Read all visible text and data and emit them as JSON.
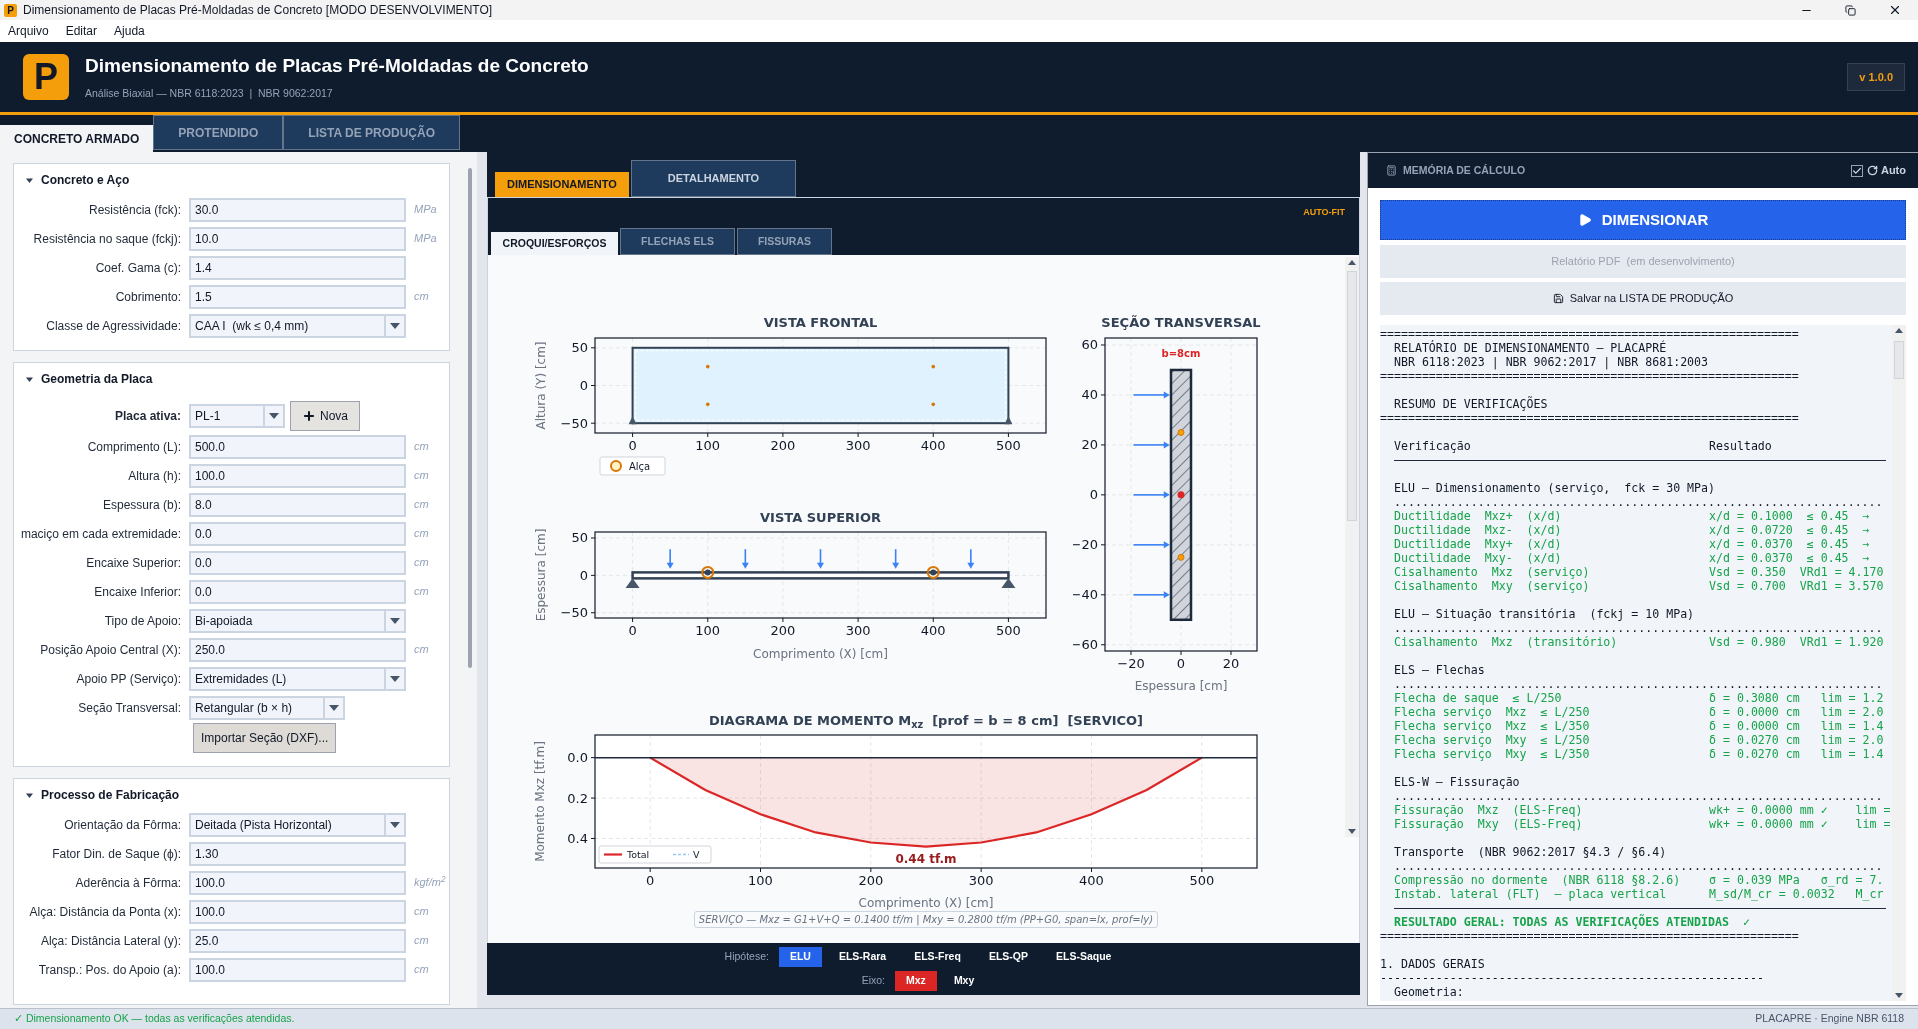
{
  "window": {
    "title": "Dimensionamento de Placas Pré-Moldadas de Concreto [MODO DESENVOLVIMENTO]",
    "app_icon": "P"
  },
  "menu": [
    "Arquivo",
    "Editar",
    "Ajuda"
  ],
  "header": {
    "logo": "P",
    "title": "Dimensionamento de Placas Pré-Moldadas de Concreto",
    "subtitle": "Análise Biaxial — NBR 6118:2023  |  NBR 9062:2017",
    "version": "v 1.0.0"
  },
  "main_tabs": [
    {
      "label": "CONCRETO ARMADO",
      "selected": true
    },
    {
      "label": "PROTENDIDO",
      "selected": false
    },
    {
      "label": "LISTA DE PRODUÇÃO",
      "selected": false
    }
  ],
  "sections": [
    {
      "title": "Concreto e Aço",
      "expanded": true,
      "fields": [
        {
          "kind": "input",
          "label": "Resistência (fck):",
          "value": "30.0",
          "unit": "MPa"
        },
        {
          "kind": "input",
          "label": "Resistência no saque (fckj):",
          "value": "10.0",
          "unit": "MPa"
        },
        {
          "kind": "input",
          "label": "Coef. Gama (c):",
          "value": "1.4"
        },
        {
          "kind": "input",
          "label": "Cobrimento:",
          "value": "1.5",
          "unit": "cm"
        },
        {
          "kind": "select",
          "label": "Classe de Agressividade:",
          "value": "CAA I  (wk ≤ 0,4 mm)"
        }
      ]
    },
    {
      "title": "Geometria da Placa",
      "expanded": true,
      "fields": [
        {
          "kind": "select_action",
          "label": "Placa ativa:",
          "value": "PL-1",
          "button": "Nova"
        },
        {
          "kind": "input",
          "label": "Comprimento (L):",
          "value": "500.0",
          "unit": "cm"
        },
        {
          "kind": "input",
          "label": "Altura (h):",
          "value": "100.0",
          "unit": "cm"
        },
        {
          "kind": "input",
          "label": "Espessura (b):",
          "value": "8.0",
          "unit": "cm"
        },
        {
          "kind": "input",
          "label": "maciço em cada extremidade:",
          "value": "0.0",
          "unit": "cm"
        },
        {
          "kind": "input",
          "label": "Encaixe Superior:",
          "value": "0.0",
          "unit": "cm"
        },
        {
          "kind": "input",
          "label": "Encaixe Inferior:",
          "value": "0.0",
          "unit": "cm"
        },
        {
          "kind": "select",
          "label": "Tipo de Apoio:",
          "value": "Bi-apoiada"
        },
        {
          "kind": "input",
          "label": "Posição Apoio Central (X):",
          "value": "250.0",
          "unit": "cm"
        },
        {
          "kind": "select",
          "label": "Apoio PP (Serviço):",
          "value": "Extremidades (L)"
        },
        {
          "kind": "select_short",
          "label": "Seção Transversal:",
          "value": "Retangular (b × h)"
        },
        {
          "kind": "button",
          "label": "Importar Seção (DXF)..."
        }
      ]
    },
    {
      "title": "Processo de Fabricação",
      "expanded": true,
      "fields": [
        {
          "kind": "select",
          "label": "Orientação da Fôrma:",
          "value": "Deitada (Pista Horizontal)"
        },
        {
          "kind": "input",
          "label": "Fator Din. de Saque (ϕ):",
          "value": "1.30"
        },
        {
          "kind": "input",
          "label": "Aderência à Fôrma:",
          "value": "100.0",
          "unit": "kgf/m$^{2}$"
        },
        {
          "kind": "input",
          "label": "Alça: Distância da Ponta (x):",
          "value": "100.0",
          "unit": "cm"
        },
        {
          "kind": "input",
          "label": "Alça: Distância Lateral (y):",
          "value": "25.0",
          "unit": "cm"
        },
        {
          "kind": "input",
          "label": "Transp.: Pos. do Apoio (a):",
          "value": "100.0",
          "unit": "cm"
        }
      ]
    }
  ],
  "workspace": {
    "tabs": [
      {
        "label": "DIMENSIONAMENTO",
        "selected": true
      },
      {
        "label": "DETALHAMENTO",
        "selected": false
      }
    ],
    "auto_fit": "AUTO-FIT",
    "subtabs": [
      {
        "label": "CROQUI/ESFORÇOS",
        "selected": true
      },
      {
        "label": "FLECHAS ELS",
        "selected": false
      },
      {
        "label": "FISSURAS",
        "selected": false
      }
    ],
    "front_view": {
      "title": "VISTA FRONTAL",
      "ylabel": "Altura (Y) [cm]",
      "legend": "Alça",
      "xticks": [
        "0",
        "100",
        "200",
        "300",
        "400",
        "500"
      ],
      "yticks": [
        "50",
        "0",
        "−50"
      ]
    },
    "top_view": {
      "title": "VISTA SUPERIOR",
      "ylabel": "Espessura [cm]",
      "xlabel": "Comprimento (X) [cm]",
      "xticks": [
        "0",
        "100",
        "200",
        "300",
        "400",
        "500"
      ],
      "yticks": [
        "50",
        "0",
        "−50"
      ]
    },
    "section_view": {
      "title": "SEÇÃO TRANSVERSAL",
      "xlabel": "Espessura [cm]",
      "width_label": "b=8cm",
      "xticks": [
        "−20",
        "0",
        "20"
      ],
      "yticks": [
        "60",
        "40",
        "20",
        "0",
        "−20",
        "−40",
        "−60"
      ]
    },
    "moment": {
      "chart_data": {
        "type": "area",
        "title": "DIAGRAMA DE MOMENTO M$_{xz}$  [prof = b = 8 cm]  [SERVICO]",
        "xlabel": "Comprimento (X) [cm]",
        "ylabel": "Momento Mxz [tf.m]",
        "x": [
          0,
          50,
          100,
          150,
          200,
          250,
          300,
          350,
          400,
          450,
          500
        ],
        "series": [
          {
            "name": "Total",
            "color": "#dc2626",
            "values": [
              0,
              0.16,
              0.28,
              0.37,
              0.42,
              0.44,
              0.42,
              0.37,
              0.28,
              0.16,
              0
            ]
          }
        ],
        "xlim": [
          -50,
          550
        ],
        "ylim": [
          0.546,
          -0.112
        ],
        "grid": true,
        "xticks": [
          0,
          100,
          200,
          300,
          400,
          500
        ],
        "yticks": [
          {
            "value": 0,
            "label": "0.0"
          },
          {
            "value": 0.2,
            "label": "0.2"
          },
          {
            "value": 0.4,
            "label": "0.4"
          }
        ],
        "annotations": [
          {
            "text": "0.44 tf.m"
          }
        ]
      },
      "legend": [
        "V"
      ],
      "note": "SERVIÇO — Mxz = G1+V+Q = 0.1400 tf/m | Mxy = 0.2800 tf/m (PP+G0, span=lx, prof=ly)"
    },
    "hypotheses": {
      "label": "Hipótese:",
      "options": [
        {
          "label": "ELU",
          "selected": true
        },
        {
          "label": "ELS-Rara",
          "selected": false
        },
        {
          "label": "ELS-Freq",
          "selected": false
        },
        {
          "label": "ELS-QP",
          "selected": false
        },
        {
          "label": "ELS-Saque",
          "selected": false
        }
      ]
    },
    "axis": {
      "label": "Eixo:",
      "options": [
        {
          "label": "Mxz",
          "selected": true
        },
        {
          "label": "Mxy",
          "selected": false
        }
      ]
    }
  },
  "memory": {
    "title": "MEMÓRIA DE CÁLCULO",
    "auto": {
      "label": "Auto",
      "checked": true
    },
    "run_button": "DIMENSIONAR",
    "pdf_button": {
      "label": "Relatório PDF  (em desenvolvimento)",
      "disabled": true
    },
    "save_button": "Salvar na LISTA DE PRODUÇÃO",
    "report": [
      {
        "kind": "text",
        "text": "============================================================"
      },
      {
        "kind": "text",
        "text": "  RELATÓRIO DE DIMENSIONAMENTO — PLACAPRÉ"
      },
      {
        "kind": "text",
        "text": "  NBR 6118:2023 | NBR 9062:2017 | NBR 8681:2003"
      },
      {
        "kind": "text",
        "text": "============================================================"
      },
      {
        "kind": "gap"
      },
      {
        "kind": "text",
        "text": "  RESUMO DE VERIFICAÇÕES"
      },
      {
        "kind": "text",
        "text": "============================================================"
      },
      {
        "kind": "gap"
      },
      {
        "kind": "text",
        "text": "  Verificação",
        "result": "Resultado"
      },
      {
        "kind": "rule"
      },
      {
        "kind": "gap"
      },
      {
        "kind": "text",
        "text": "  ELU — Dimensionamento (serviço,  fck = 30 MPa)"
      },
      {
        "kind": "text",
        "text": "  ......................................................................"
      },
      {
        "kind": "ok",
        "text": "  Ductilidade  Mxz+  (x/d)",
        "result": "x/d = 0.1000  ≤ 0.45  →"
      },
      {
        "kind": "ok",
        "text": "  Ductilidade  Mxz-  (x/d)",
        "result": "x/d = 0.0720  ≤ 0.45  →"
      },
      {
        "kind": "ok",
        "text": "  Ductilidade  Mxy+  (x/d)",
        "result": "x/d = 0.0370  ≤ 0.45  →"
      },
      {
        "kind": "ok",
        "text": "  Ductilidade  Mxy-  (x/d)",
        "result": "x/d = 0.0370  ≤ 0.45  →"
      },
      {
        "kind": "ok",
        "text": "  Cisalhamento  Mxz  (serviço)",
        "result": "Vsd = 0.350  VRd1 = 4.170"
      },
      {
        "kind": "ok",
        "text": "  Cisalhamento  Mxy  (serviço)",
        "result": "Vsd = 0.700  VRd1 = 3.570"
      },
      {
        "kind": "gap"
      },
      {
        "kind": "text",
        "text": "  ELU — Situação transitória  (fckj = 10 MPa)"
      },
      {
        "kind": "text",
        "text": "  ......................................................................"
      },
      {
        "kind": "ok",
        "text": "  Cisalhamento  Mxz  (transitório)",
        "result": "Vsd = 0.980  VRd1 = 1.920"
      },
      {
        "kind": "gap"
      },
      {
        "kind": "text",
        "text": "  ELS — Flechas"
      },
      {
        "kind": "text",
        "text": "  ......................................................................"
      },
      {
        "kind": "ok",
        "text": "  Flecha de saque  ≤ L/250",
        "result": "δ = 0.3080 cm   lim = 1.2"
      },
      {
        "kind": "ok",
        "text": "  Flecha serviço  Mxz  ≤ L/250",
        "result": "δ = 0.0000 cm   lim = 2.0"
      },
      {
        "kind": "ok",
        "text": "  Flecha serviço  Mxz  ≤ L/350",
        "result": "δ = 0.0000 cm   lim = 1.4"
      },
      {
        "kind": "ok",
        "text": "  Flecha serviço  Mxy  ≤ L/250",
        "result": "δ = 0.0270 cm   lim = 2.0"
      },
      {
        "kind": "ok",
        "text": "  Flecha serviço  Mxy  ≤ L/350",
        "result": "δ = 0.0270 cm   lim = 1.4"
      },
      {
        "kind": "gap"
      },
      {
        "kind": "text",
        "text": "  ELS-W — Fissuração"
      },
      {
        "kind": "text",
        "text": "  ......................................................................"
      },
      {
        "kind": "ok",
        "text": "  Fissuração  Mxz  (ELS-Freq)",
        "result": "wk+ = 0.0000 mm ✓    lim ="
      },
      {
        "kind": "ok",
        "text": "  Fissuração  Mxy  (ELS-Freq)",
        "result": "wk+ = 0.0000 mm ✓    lim ="
      },
      {
        "kind": "gap"
      },
      {
        "kind": "text",
        "text": "  Transporte  (NBR 9062:2017 §4.3 / §6.4)"
      },
      {
        "kind": "text",
        "text": "  ......................................................................"
      },
      {
        "kind": "ok",
        "text": "  Compressão no dormente  (NBR 6118 §8.2.6)",
        "result": "σ = 0.039 MPa   σ_rd = 7."
      },
      {
        "kind": "ok",
        "text": "  Instab. lateral (FLT)  — placa vertical",
        "result": "M_sd/M_cr = 0.0032   M_cr"
      },
      {
        "kind": "rule"
      },
      {
        "kind": "total",
        "text": "  RESULTADO GERAL: TODAS AS VERIFICAÇÕES ATENDIDAS  ✓"
      },
      {
        "kind": "text",
        "text": "============================================================"
      },
      {
        "kind": "gap"
      },
      {
        "kind": "text",
        "text": "1. DADOS GERAIS"
      },
      {
        "kind": "text",
        "text": "-------------------------------------------------------"
      },
      {
        "kind": "text",
        "text": "  Geometria:"
      }
    ]
  },
  "status_bar": {
    "message": "✓ Dimensionamento OK — todas as verificações atendidas.",
    "engine": "PLACAPRE · Engine NBR 6118"
  }
}
